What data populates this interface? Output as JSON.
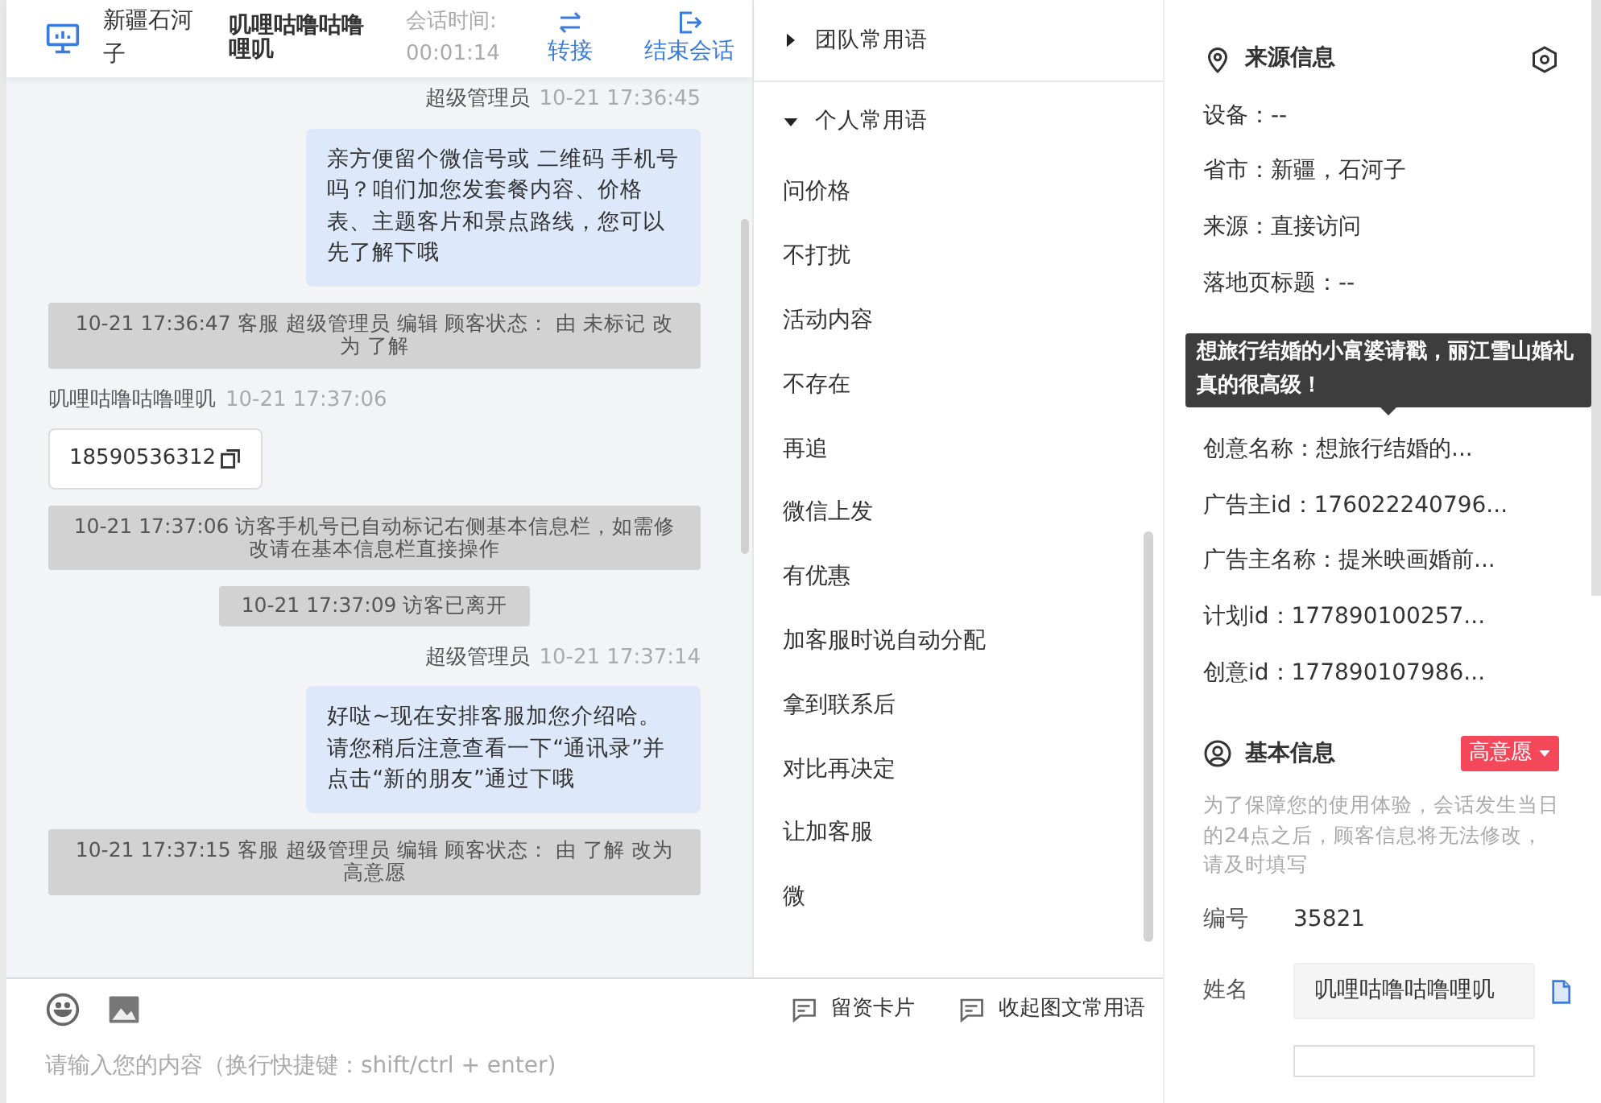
{
  "header": {
    "location": "新疆石河子",
    "visitor": "叽哩咕噜咕噜哩叽",
    "duration_label": "会话时间:",
    "duration": "00:01:14",
    "actions": [
      {
        "kind": "transfer",
        "label": "转接"
      },
      {
        "kind": "end",
        "label": "结束会话"
      }
    ]
  },
  "messages": [
    {
      "kind": "outgoing",
      "sender": "超级管理员",
      "time": "10-21 17:36:45",
      "text": "亲方便留个微信号或 二维码 手机号吗？咱们加您发套餐内容、价格表、主题客片和景点路线，您可以先了解下哦"
    },
    {
      "kind": "system",
      "wide": true,
      "text": "10-21 17:36:47 客服 超级管理员 编辑 顾客状态： 由 未标记 改为 了解"
    },
    {
      "kind": "incoming",
      "sender": "叽哩咕噜咕噜哩叽",
      "time": "10-21 17:37:06",
      "text": "18590536312"
    },
    {
      "kind": "system",
      "wide": true,
      "text": "10-21 17:37:06 访客手机号已自动标记右侧基本信息栏，如需修改请在基本信息栏直接操作"
    },
    {
      "kind": "system",
      "wide": false,
      "text": "10-21 17:37:09 访客已离开"
    },
    {
      "kind": "outgoing",
      "sender": "超级管理员",
      "time": "10-21 17:37:14",
      "text": "好哒~现在安排客服加您介绍哈。请您稍后注意查看一下“通讯录”并点击“新的朋友”通过下哦"
    },
    {
      "kind": "system",
      "wide": true,
      "text": "10-21 17:37:15 客服 超级管理员 编辑 顾客状态： 由 了解 改为高意愿"
    }
  ],
  "phrase_groups": [
    {
      "title": "团队常用语",
      "expanded": false
    },
    {
      "title": "个人常用语",
      "expanded": true,
      "items": [
        "问价格",
        "不打扰",
        "活动内容",
        "不存在",
        "再追",
        "微信上发",
        "有优惠",
        "加客服时说自动分配",
        "拿到联系后",
        "对比再决定",
        "让加客服",
        "微"
      ]
    }
  ],
  "toolbar": {
    "tools": [
      {
        "kind": "emoji"
      },
      {
        "kind": "image"
      }
    ],
    "actions": [
      "留资卡片",
      "收起图文常用语"
    ],
    "input_placeholder": "请输入您的内容（换行快捷键：shift/ctrl + enter)"
  },
  "source_info": {
    "title": "来源信息",
    "rows_before": [
      "设备：--",
      "省市：新疆，石河子",
      "来源：直接访问",
      "落地页标题：--"
    ],
    "tooltip": "想旅行结婚的小富婆请戳，丽江雪山婚礼真的很高级！",
    "rows_after": [
      "创意名称：想旅行结婚的...",
      "广告主id：176022240796...",
      "广告主名称：提米映画婚前...",
      "计划id：177890100257...",
      "创意id：177890107986..."
    ]
  },
  "basic_info": {
    "title": "基本信息",
    "status": "高意愿",
    "note": "为了保障您的使用体验，会话发生当日的24点之后，顾客信息将无法修改，请及时填写",
    "fields": [
      {
        "kind": "text",
        "label": "编号",
        "value": "35821"
      },
      {
        "kind": "input",
        "label": "姓名",
        "value": "叽哩咕噜咕噜哩叽"
      }
    ]
  }
}
